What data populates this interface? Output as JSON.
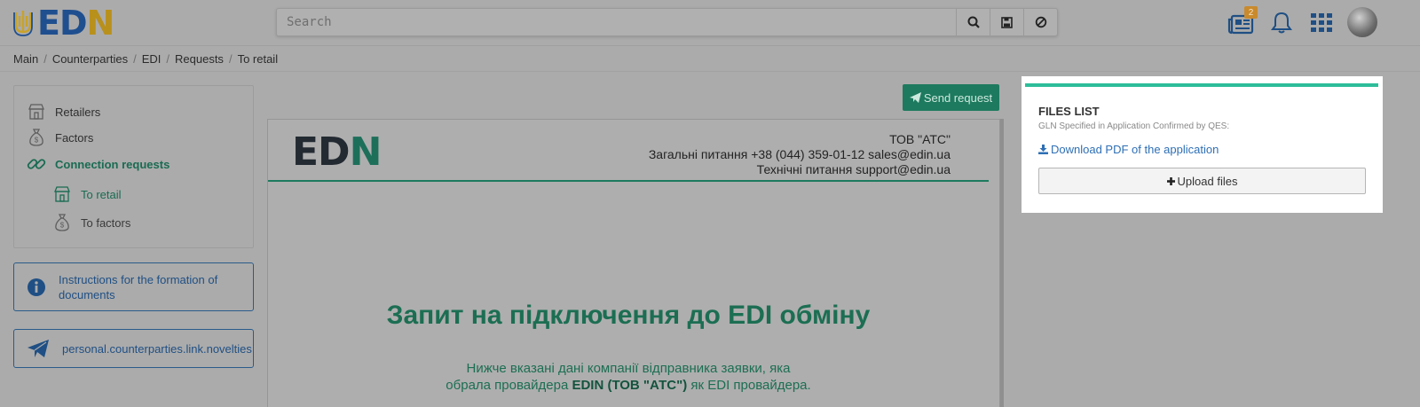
{
  "header": {
    "logo_text": "EDIN",
    "search_placeholder": "Search",
    "notifications_count": "2",
    "icons": [
      "news-icon",
      "bell-icon",
      "apps-grid-icon",
      "avatar"
    ]
  },
  "breadcrumb": [
    "Main",
    "Counterparties",
    "EDI",
    "Requests",
    "To retail"
  ],
  "sidebar": {
    "items": [
      {
        "label": "Retailers",
        "icon": "store-icon"
      },
      {
        "label": "Factors",
        "icon": "money-bag-icon"
      },
      {
        "label": "Connection requests",
        "icon": "link-icon"
      }
    ],
    "subitems": [
      {
        "label": "To retail",
        "icon": "store-icon"
      },
      {
        "label": "To factors",
        "icon": "money-bag-icon"
      }
    ]
  },
  "info_boxes": {
    "instructions": "Instructions for the formation of documents",
    "novelties": "personal.counterparties.link.novelties"
  },
  "actions": {
    "send_request": "Send request"
  },
  "document": {
    "logo": "EDIN",
    "company": "ТОВ \"АТС\"",
    "contact_general": "Загальні питання +38 (044) 359-01-12 sales@edin.ua",
    "contact_tech": "Технічні питання support@edin.ua",
    "title": "Запит на підключення до EDI обміну",
    "subtitle_line1": "Нижче вказані дані компанії відправника заявки, яка",
    "subtitle_line2_pre": "обрала провайдера ",
    "subtitle_line2_bold": "EDIN (ТОВ \"АТС\")",
    "subtitle_line2_post": " як EDI провайдера."
  },
  "files_panel": {
    "title": "FILES LIST",
    "subtitle": "GLN Specified in Application Confirmed by QES:",
    "download_link": "Download PDF of the application",
    "upload_button": "Upload files"
  },
  "colors": {
    "accent_green": "#1d7a5e",
    "panel_bar": "#2ebd9a",
    "link_blue": "#2e6fb5",
    "badge": "#c98a2d"
  }
}
